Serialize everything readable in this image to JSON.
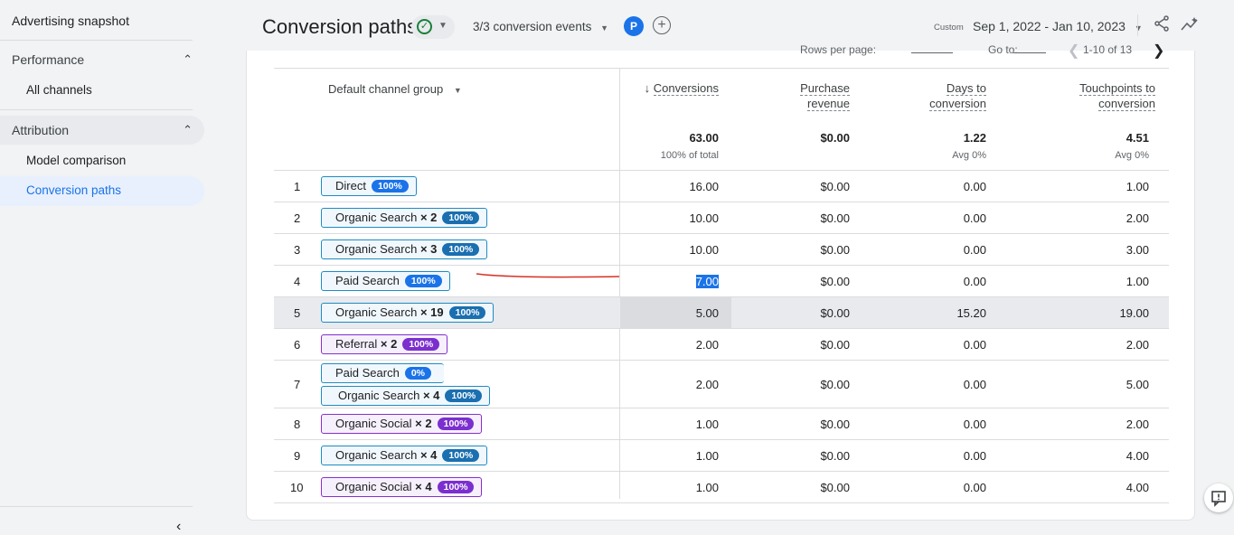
{
  "sidebar": {
    "top_item": "Advertising snapshot",
    "sections": [
      {
        "label": "Performance",
        "items": [
          "All channels"
        ]
      },
      {
        "label": "Attribution",
        "items": [
          "Model comparison",
          "Conversion paths"
        ]
      }
    ],
    "active_item": "Conversion paths"
  },
  "header": {
    "title": "Conversion paths",
    "events": "3/3 conversion events",
    "avatar": "P",
    "date_prefix": "Custom",
    "date_range": "Sep 1, 2022 - Jan 10, 2023"
  },
  "pager": {
    "rows_per_page": "Rows per page:",
    "go_to": "Go to:",
    "range": "1-10 of 13"
  },
  "table": {
    "dim_header": "Default channel group",
    "columns": [
      {
        "l1": "Conversions",
        "l2": ""
      },
      {
        "l1": "Purchase",
        "l2": "revenue"
      },
      {
        "l1": "Days to",
        "l2": "conversion"
      },
      {
        "l1": "Touchpoints to",
        "l2": "conversion"
      }
    ],
    "totals": [
      "63.00",
      "$0.00",
      "1.22",
      "4.51"
    ],
    "totals_sub": [
      "100% of total",
      "",
      "Avg 0%",
      "Avg 0%"
    ],
    "rows": [
      {
        "n": "1",
        "paths": [
          {
            "name": "Direct",
            "mult": "",
            "pct": "100%"
          }
        ],
        "vals": [
          "16.00",
          "$0.00",
          "0.00",
          "1.00"
        ]
      },
      {
        "n": "2",
        "paths": [
          {
            "name": "Organic Search",
            "mult": "× 2",
            "pct": "100%"
          }
        ],
        "vals": [
          "10.00",
          "$0.00",
          "0.00",
          "2.00"
        ]
      },
      {
        "n": "3",
        "paths": [
          {
            "name": "Organic Search",
            "mult": "× 3",
            "pct": "100%"
          }
        ],
        "vals": [
          "10.00",
          "$0.00",
          "0.00",
          "3.00"
        ]
      },
      {
        "n": "4",
        "paths": [
          {
            "name": "Paid Search",
            "mult": "",
            "pct": "100%"
          }
        ],
        "vals": [
          "7.00",
          "$0.00",
          "0.00",
          "1.00"
        ]
      },
      {
        "n": "5",
        "paths": [
          {
            "name": "Organic Search",
            "mult": "× 19",
            "pct": "100%"
          }
        ],
        "vals": [
          "5.00",
          "$0.00",
          "15.20",
          "19.00"
        ]
      },
      {
        "n": "6",
        "paths": [
          {
            "name": "Referral",
            "mult": "× 2",
            "pct": "100%"
          }
        ],
        "vals": [
          "2.00",
          "$0.00",
          "0.00",
          "2.00"
        ]
      },
      {
        "n": "7",
        "paths": [
          {
            "name": "Paid Search",
            "mult": "",
            "pct": "0%"
          },
          {
            "name": "Organic Search",
            "mult": "× 4",
            "pct": "100%"
          }
        ],
        "vals": [
          "2.00",
          "$0.00",
          "0.00",
          "5.00"
        ]
      },
      {
        "n": "8",
        "paths": [
          {
            "name": "Organic Social",
            "mult": "× 2",
            "pct": "100%"
          }
        ],
        "vals": [
          "1.00",
          "$0.00",
          "0.00",
          "2.00"
        ]
      },
      {
        "n": "9",
        "paths": [
          {
            "name": "Organic Search",
            "mult": "× 4",
            "pct": "100%"
          }
        ],
        "vals": [
          "1.00",
          "$0.00",
          "0.00",
          "4.00"
        ]
      },
      {
        "n": "10",
        "paths": [
          {
            "name": "Organic Social",
            "mult": "× 4",
            "pct": "100%"
          }
        ],
        "vals": [
          "1.00",
          "$0.00",
          "0.00",
          "4.00"
        ]
      }
    ]
  },
  "colors": {
    "accent": "#1a73e8",
    "search_chip": "#1e8bc3",
    "social_chip": "#8430ce"
  }
}
